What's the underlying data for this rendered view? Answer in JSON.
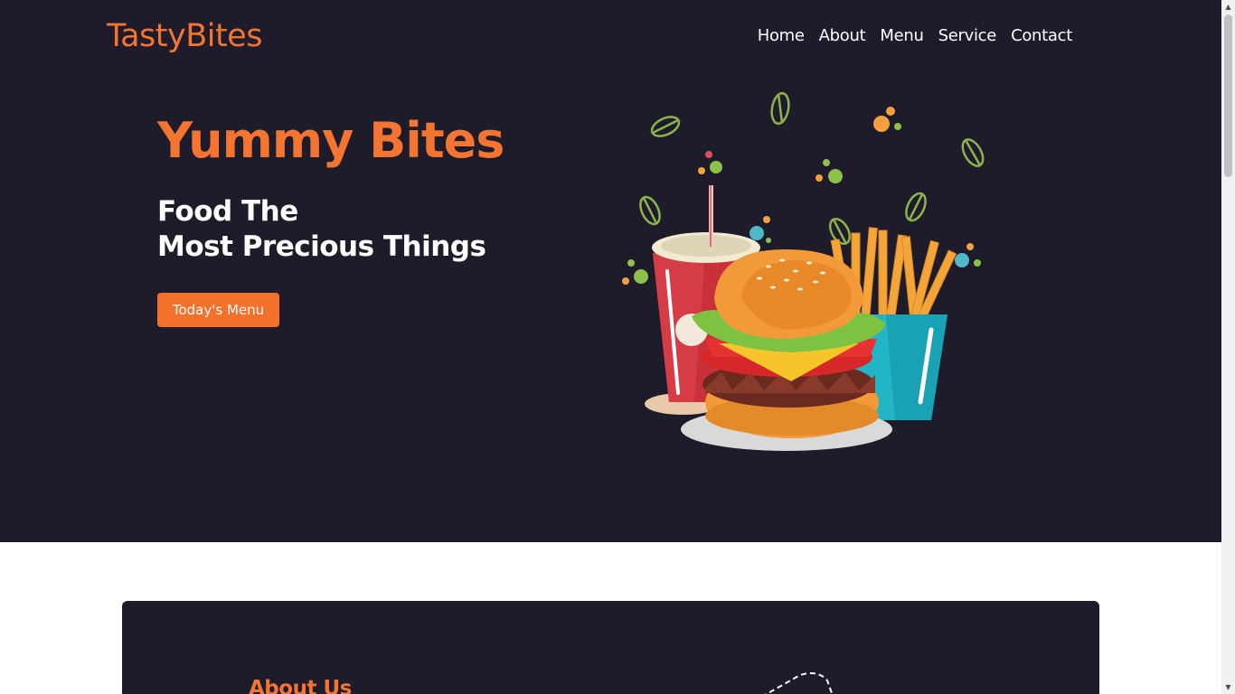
{
  "header": {
    "logo": "TastyBites",
    "nav": [
      {
        "label": "Home"
      },
      {
        "label": "About"
      },
      {
        "label": "Menu"
      },
      {
        "label": "Service"
      },
      {
        "label": "Contact"
      }
    ]
  },
  "hero": {
    "title": "Yummy Bites",
    "subtitle_line1": "Food The",
    "subtitle_line2": "Most Precious Things",
    "button_label": "Today's Menu",
    "illustration": "burger-fries-drink-illustration"
  },
  "about": {
    "title": "About Us"
  },
  "colors": {
    "accent": "#f47432",
    "dark_bg": "#1e1c2a",
    "text_light": "#ffffff"
  }
}
